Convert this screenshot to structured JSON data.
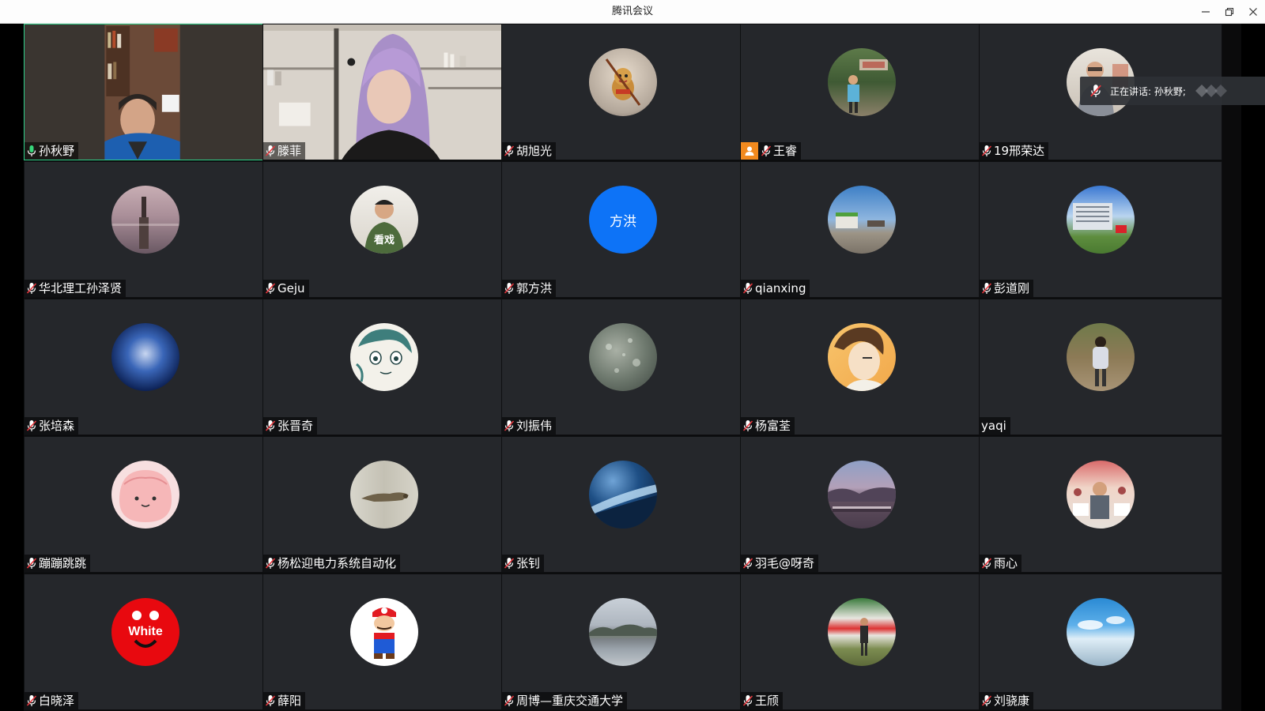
{
  "window": {
    "title": "腾讯会议"
  },
  "speaking_indicator": {
    "text": "正在讲话: 孙秋野;"
  },
  "participants": [
    {
      "name": "孙秋野",
      "mic": "on",
      "video": "on"
    },
    {
      "name": "滕菲",
      "mic": "off",
      "video": "on"
    },
    {
      "name": "胡旭光",
      "mic": "off",
      "avatar": "cartoon-monkey-avatar"
    },
    {
      "name": "王睿",
      "mic": "off",
      "host": true,
      "avatar": "outdoor-photo-avatar"
    },
    {
      "name": "19邢荣达",
      "mic": "off",
      "avatar": "person-photo-avatar"
    },
    {
      "name": "华北理工孙泽贤",
      "mic": "off",
      "avatar": "pier-sunset-avatar"
    },
    {
      "name": "Geju",
      "mic": "off",
      "avatar": "看戏"
    },
    {
      "name": "郭方洪",
      "mic": "off",
      "avatar": "方洪"
    },
    {
      "name": "qianxing",
      "mic": "off",
      "avatar": "sky-building-avatar"
    },
    {
      "name": "彭道刚",
      "mic": "off",
      "avatar": "campus-building-avatar"
    },
    {
      "name": "张培森",
      "mic": "off",
      "avatar": "moon-avatar"
    },
    {
      "name": "张晋奇",
      "mic": "off",
      "avatar": "sketch-face-avatar"
    },
    {
      "name": "刘振伟",
      "mic": "off",
      "avatar": "raindrops-avatar"
    },
    {
      "name": "杨富荃",
      "mic": "off",
      "avatar": "anime-boy-avatar"
    },
    {
      "name": "yaqi",
      "mic": "none",
      "avatar": "hiker-avatar"
    },
    {
      "name": "蹦蹦跳跳",
      "mic": "off",
      "avatar": "pink-blob-avatar"
    },
    {
      "name": "杨松迎电力系统自动化",
      "mic": "off",
      "avatar": "bird-avatar"
    },
    {
      "name": "张钊",
      "mic": "off",
      "avatar": "planet-avatar"
    },
    {
      "name": "羽毛@呀奇",
      "mic": "off",
      "avatar": "lake-bridge-avatar"
    },
    {
      "name": "雨心",
      "mic": "off",
      "avatar": "event-photo-avatar"
    },
    {
      "name": "白晓泽",
      "mic": "off",
      "avatar": "White"
    },
    {
      "name": "薛阳",
      "mic": "off",
      "avatar": "mario-avatar"
    },
    {
      "name": "周博—重庆交通大学",
      "mic": "off",
      "avatar": "lake-mountain-avatar"
    },
    {
      "name": "王颀",
      "mic": "off",
      "avatar": "sports-field-avatar"
    },
    {
      "name": "刘骁康",
      "mic": "off",
      "avatar": "blue-sky-avatar"
    }
  ],
  "colors": {
    "tile_bg": "#25272b",
    "active_border": "#2fd08a",
    "host_badge": "#f28a1e",
    "text_avatar_blue": "#0d73f7",
    "white_avatar_red": "#e8090f"
  }
}
